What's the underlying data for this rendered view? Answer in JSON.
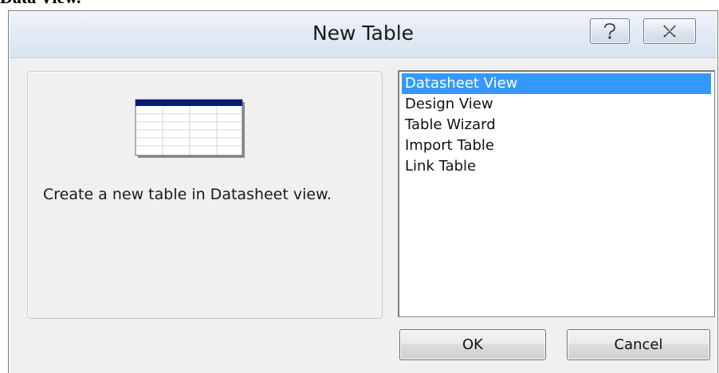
{
  "background_text": "Data View.",
  "dialog": {
    "title": "New Table",
    "help_icon": "question-mark-icon",
    "close_icon": "close-x-icon"
  },
  "preview": {
    "icon": "datasheet-table-icon",
    "description": "Create a new table in Datasheet view."
  },
  "list": {
    "items": [
      {
        "label": "Datasheet View",
        "selected": true
      },
      {
        "label": "Design View",
        "selected": false
      },
      {
        "label": "Table Wizard",
        "selected": false
      },
      {
        "label": "Import Table",
        "selected": false
      },
      {
        "label": "Link Table",
        "selected": false
      }
    ]
  },
  "buttons": {
    "ok_label": "OK",
    "cancel_label": "Cancel"
  },
  "colors": {
    "selection": "#3399ff",
    "titlebar": "#dfe8f3",
    "table_header": "#0a1a7a"
  }
}
